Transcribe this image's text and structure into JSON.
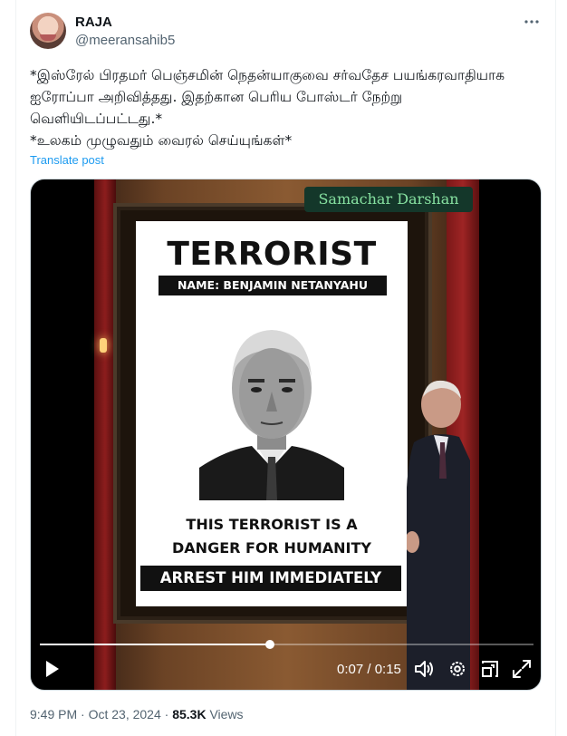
{
  "author": {
    "display_name": "RAJA",
    "handle": "@meeransahib5"
  },
  "tweet": {
    "text": "*இஸ்ரேல் பிரதமர் பெஞ்சமின் நெதன்யாகுவை சர்வதேச பயங்கரவாதியாக ஐரோப்பா அறிவித்தது. இதற்கான பெரிய போஸ்டர் நேற்று வெளியிடப்பட்டது.*\n*உலகம் முழுவதும் வைரல் செய்யுங்கள்*",
    "translate_label": "Translate post"
  },
  "video": {
    "watermark": "Samachar Darshan",
    "poster_title": "TERRORIST",
    "poster_name": "NAME: BENJAMIN NETANYAHU",
    "poster_line1": "THIS TERRORIST IS A",
    "poster_line2": "DANGER FOR HUMANITY",
    "poster_banner": "ARREST HIM IMMEDIATELY",
    "time_display": "0:07 / 0:15",
    "progress_fraction": 0.4667
  },
  "meta": {
    "time": "9:49 PM",
    "separator": " · ",
    "date": "Oct 23, 2024",
    "views_count": "85.3K",
    "views_label": " Views"
  },
  "icons": {
    "more": "more-horizontal-icon",
    "play": "play-icon",
    "volume": "volume-icon",
    "settings": "gear-icon",
    "pip": "picture-in-picture-icon",
    "fullscreen": "fullscreen-icon"
  }
}
